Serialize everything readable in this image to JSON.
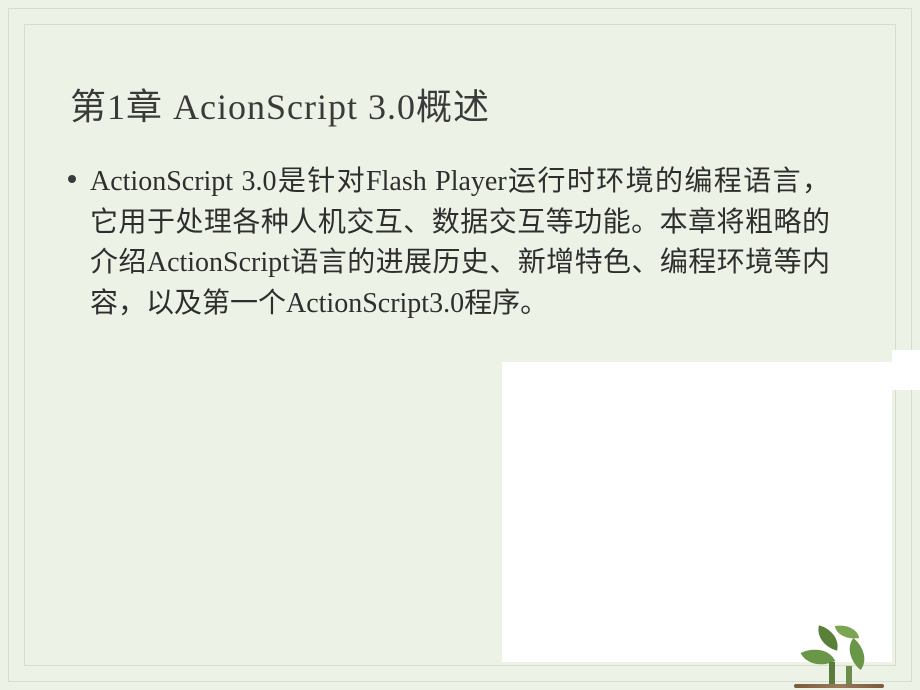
{
  "title": "第1章  AcionScript 3.0概述",
  "body": "ActionScript 3.0是针对Flash Player运行时环境的编程语言，它用于处理各种人机交互、数据交互等功能。本章将粗略的介绍ActionScript语言的进展历史、新增特色、编程环境等内容，以及第一个ActionScript3.0程序。"
}
